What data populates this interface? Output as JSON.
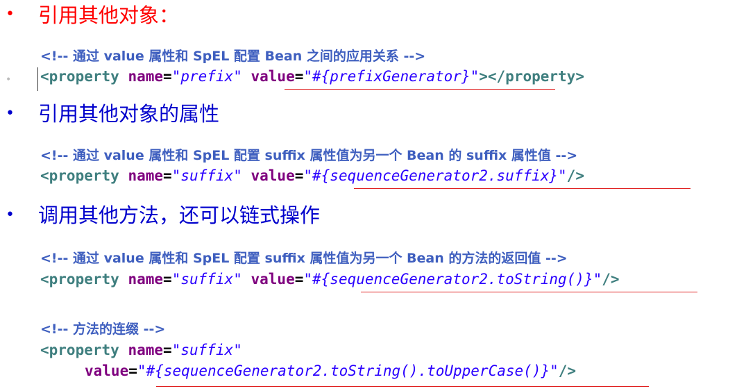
{
  "section1": {
    "bullet": "•",
    "heading": "引用其他对象：",
    "heading_color": "#ff0000",
    "comment": "<!-- 通过 value 属性和 SpEL 配置 Bean 之间的应用关系 -->",
    "code": {
      "tag_open": "<property",
      "attr_name": "name",
      "name_value": "\"prefix\"",
      "attr_value": "value",
      "value_value": "\"#{prefixGenerator}\"",
      "tag_close": "></property>"
    }
  },
  "section2": {
    "bullet": "•",
    "heading": "引用其他对象的属性",
    "heading_color": "#0000cc",
    "comment": "<!-- 通过 value 属性和 SpEL 配置 suffix 属性值为另一个 Bean 的 suffix 属性值 -->",
    "code": {
      "tag_open": "<property",
      "attr_name": "name",
      "name_value": "\"suffix\"",
      "attr_value": "value",
      "value_value": "\"#{sequenceGenerator2.suffix}\"",
      "tag_close": "/>"
    }
  },
  "section3": {
    "bullet": "•",
    "heading": "调用其他方法，还可以链式操作",
    "heading_color": "#0000cc",
    "comment": "<!-- 通过 value 属性和 SpEL 配置 suffix 属性值为另一个 Bean 的方法的返回值 -->",
    "code": {
      "tag_open": "<property",
      "attr_name": "name",
      "name_value": "\"suffix\"",
      "attr_value": "value",
      "value_value": "\"#{sequenceGenerator2.toString()}\"",
      "tag_close": "/>"
    },
    "comment2": "<!-- 方法的连缀 -->",
    "code2": {
      "tag_open": "<property",
      "attr_name": "name",
      "name_value": "\"suffix\"",
      "attr_value": "value",
      "value_value": "\"#{sequenceGenerator2.toString().toUpperCase()}\"",
      "tag_close": "/>"
    }
  }
}
